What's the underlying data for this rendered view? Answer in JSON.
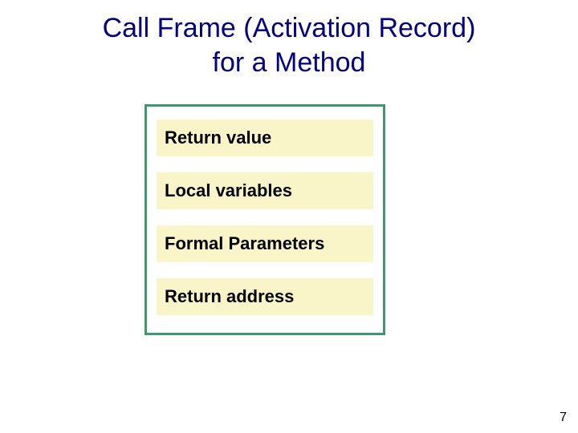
{
  "title_line1": "Call Frame (Activation Record)",
  "title_line2": "for a Method",
  "slots": {
    "s0": "Return value",
    "s1": "Local variables",
    "s2": "Formal Parameters",
    "s3": "Return address"
  },
  "page_number": "7"
}
